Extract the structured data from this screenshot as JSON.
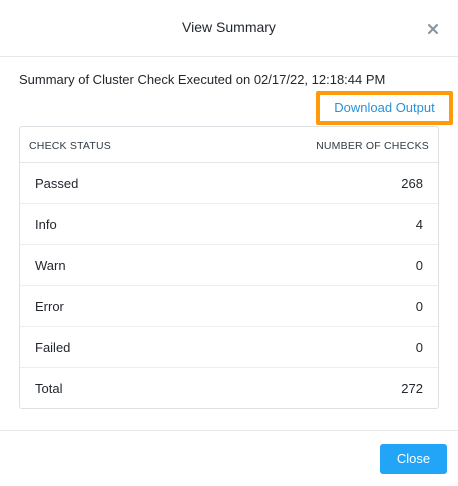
{
  "dialog": {
    "title": "View Summary",
    "close_icon": "close-icon"
  },
  "summary": {
    "text": "Summary of Cluster Check Executed on 02/17/22, 12:18:44 PM",
    "download_label": "Download Output"
  },
  "table": {
    "headers": {
      "status": "CHECK STATUS",
      "count": "NUMBER OF CHECKS"
    },
    "rows": [
      {
        "label": "Passed",
        "value": "268"
      },
      {
        "label": "Info",
        "value": "4"
      },
      {
        "label": "Warn",
        "value": "0"
      },
      {
        "label": "Error",
        "value": "0"
      },
      {
        "label": "Failed",
        "value": "0"
      },
      {
        "label": "Total",
        "value": "272"
      }
    ]
  },
  "footer": {
    "close_label": "Close"
  },
  "colors": {
    "accent": "#22a5f7",
    "link": "#2a91d8",
    "highlight": "#ff9a0a"
  }
}
